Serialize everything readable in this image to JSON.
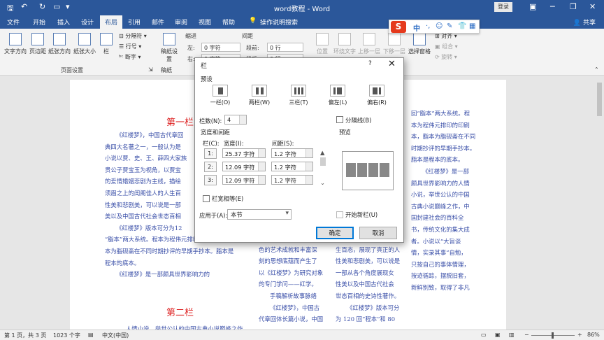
{
  "window": {
    "title": "word教程 - Word",
    "login": "登录"
  },
  "tabs": [
    "文件",
    "开始",
    "插入",
    "设计",
    "布局",
    "引用",
    "邮件",
    "审阅",
    "视图",
    "帮助",
    "操作说明搜索"
  ],
  "active_tab": "布局",
  "share": "共享",
  "ribbon": {
    "text_direction": "文字方向",
    "margins": "页边距",
    "orientation": "纸张方向",
    "size": "纸张大小",
    "columns": "栏",
    "breaks": "分隔符",
    "line_numbers": "行号",
    "hyphenation": "断字",
    "page_setup_group": "页面设置",
    "draft_paper": "稿纸设置",
    "draft_paper_group": "稿纸",
    "indent": "缩进",
    "spacing": "间距",
    "indent_left_label": "左:",
    "indent_left_value": "0 字符",
    "indent_right_label": "右:",
    "indent_right_value": "0 字符",
    "spacing_before_label": "段前:",
    "spacing_before_value": "0 行",
    "spacing_after_label": "段后:",
    "spacing_after_value": "0 行",
    "position": "位置",
    "wrap_text": "环绕文字",
    "bring_forward": "上移一层",
    "send_backward": "下移一层",
    "selection_pane": "选择窗格",
    "align": "对齐",
    "group": "组合",
    "rotate": "旋转"
  },
  "ime": {
    "logo": "S",
    "items": [
      "中",
      "·,",
      "☺",
      "✎",
      "👕",
      "▦"
    ]
  },
  "document": {
    "heading1": "第一栏",
    "heading2": "第二栏",
    "col1": [
      "《红楼梦》，中国古代章回",
      "典四大名著之一，一般认为是",
      "小说以贾、史、王、薛四大家族",
      "贵公子贾宝玉为视角，以贾宝",
      "的爱情婚姻悲剧为主线，描绘",
      "须眉之上的闺阁佳人的人生百",
      "性美和悲剧美，可以说是一部",
      "美以及中国古代社会世态百相",
      "《红楼梦》版本可分为12",
      "“脂本”两大系统。程本为程伟元排印的印刷本，脂",
      "本为脂砚斋在不同时期抄评的早期手抄本。脂本是",
      "程本的底本。",
      "《红楼梦》是一部颇具世界影响力的"
    ],
    "col2": [
      "术界因《红楼梦》异常出",
      "色的艺术成就和丰富深",
      "刻的思想底蕴而产生了",
      "以《红楼梦》为研究对象",
      "的专门学问——红学。",
      "手稿解析故事脉络",
      "《红楼梦》，中国古",
      "代章回体长篇小说，中国"
    ],
    "col3a": [
      "须眉之上的闺阁佳人的人",
      "生百态，展现了真正的人",
      "性美和悲剧美，可以说是",
      "一部从各个角度展现女",
      "性美以及中国古代社会",
      "世态百相的史诗性著作。",
      "《红楼梦》版本可分",
      "为 120 回“程本”和 80"
    ],
    "col3": [
      "回“脂本”两大系统。程",
      "本为程伟元排印的印刷",
      "本，脂本为脂砚斋在不同",
      "时期抄评的早期手抄本。",
      "脂本是程本的底本。",
      "《红楼梦》是一部",
      "颇具世界影响力的人情",
      "小说，举世公认的中国",
      "古典小说巅峰之作，中",
      "国封建社会的百科全",
      "书，传统文化的集大成",
      "者。小说以“大旨谈",
      "情，实录其事”自勉，",
      "只按自己的事体情理，",
      "按迹循踪，摆脱旧套，",
      "新鲜别致，取得了非凡"
    ],
    "bottom_left": "人情小说，举世公认的中国古典小说巅峰之作"
  },
  "dialog": {
    "title": "栏",
    "help": "?",
    "close": "✕",
    "presets_label": "预设",
    "presets": [
      "一栏(O)",
      "两栏(W)",
      "三栏(T)",
      "偏左(L)",
      "偏右(R)"
    ],
    "num_columns_label": "栏数(N):",
    "num_columns_value": "4",
    "line_between_label": "分隔线(B)",
    "width_spacing_label": "宽度和间距",
    "preview_label": "预览",
    "col_header": "栏(C):",
    "width_header": "宽度(I):",
    "spacing_header": "间距(S):",
    "rows": [
      {
        "num": "1:",
        "width": "25.37 字符",
        "spacing": "1.2 字符"
      },
      {
        "num": "2:",
        "width": "12.09 字符",
        "spacing": "1.2 字符"
      },
      {
        "num": "3:",
        "width": "12.09 字符",
        "spacing": "1.2 字符"
      }
    ],
    "equal_width_label": "栏宽相等(E)",
    "apply_to_label": "应用于(A):",
    "apply_to_value": "本节",
    "new_column_label": "开始新栏(U)",
    "ok": "确定",
    "cancel": "取消"
  },
  "status": {
    "page": "第 1 页，共 3 页",
    "words": "1023 个字",
    "language": "中文(中国)",
    "zoom": "86%"
  }
}
